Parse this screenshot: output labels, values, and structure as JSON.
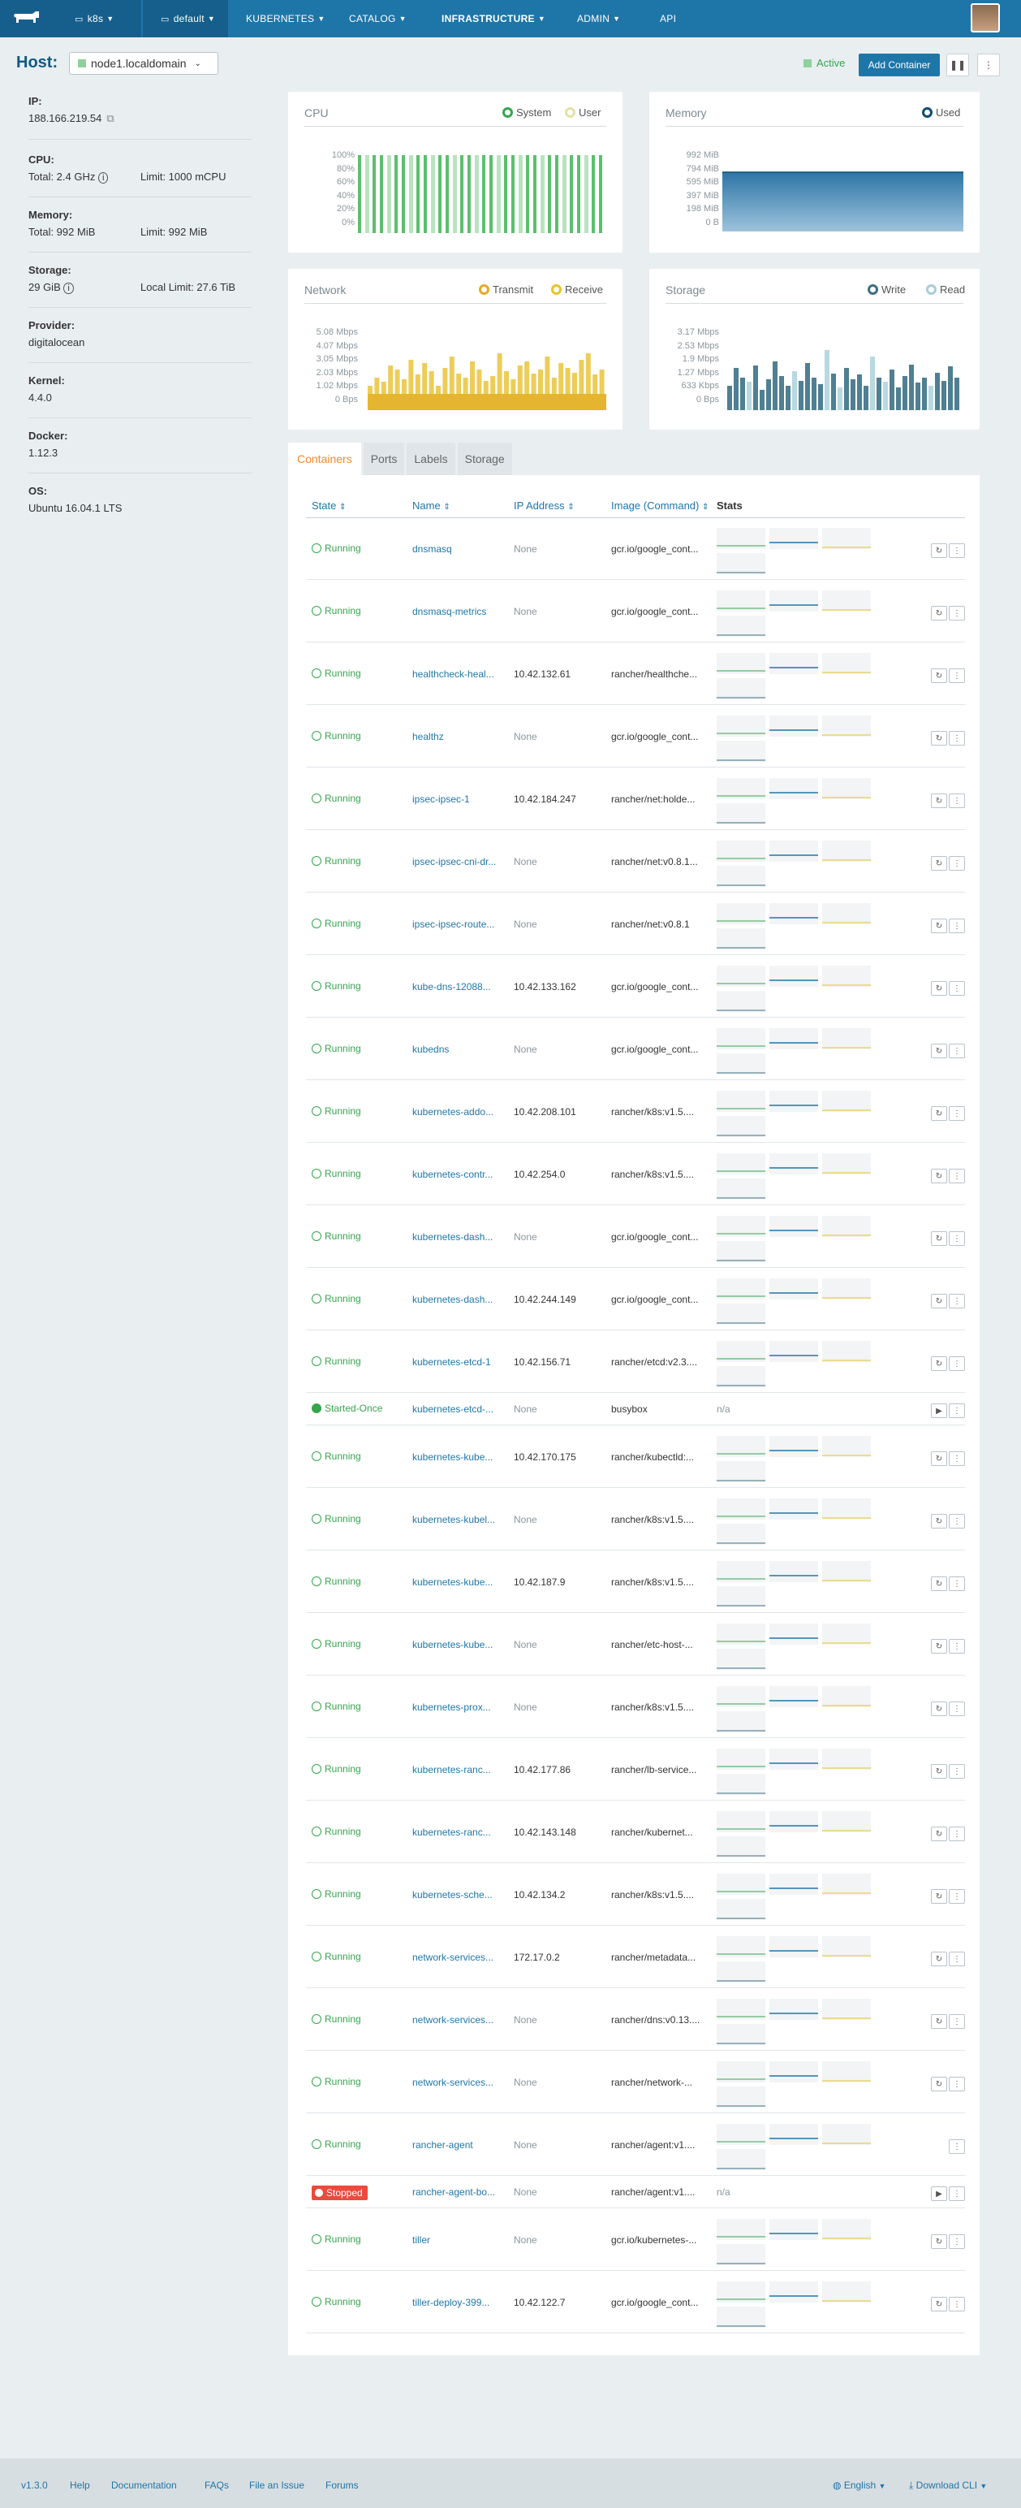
{
  "nav": {
    "cluster": "k8s",
    "environment": "default",
    "menu": [
      "KUBERNETES",
      "CATALOG",
      "INFRASTRUCTURE",
      "ADMIN",
      "API"
    ]
  },
  "host": {
    "label": "Host:",
    "name": "node1.localdomain",
    "state": "Active",
    "add_container": "Add Container"
  },
  "info": {
    "ip_label": "IP:",
    "ip": "188.166.219.54",
    "cpu_label": "CPU:",
    "cpu_total": "Total: 2.4 GHz",
    "cpu_limit": "Limit: 1000 mCPU",
    "mem_label": "Memory:",
    "mem_total": "Total: 992 MiB",
    "mem_limit": "Limit: 992 MiB",
    "storage_label": "Storage:",
    "storage_total": "29 GiB",
    "storage_limit": "Local Limit: 27.6 TiB",
    "provider_label": "Provider:",
    "provider": "digitalocean",
    "kernel_label": "Kernel:",
    "kernel": "4.4.0",
    "docker_label": "Docker:",
    "docker": "1.12.3",
    "os_label": "OS:",
    "os": "Ubuntu 16.04.1 LTS"
  },
  "charts": {
    "cpu": {
      "title": "CPU",
      "legend": [
        "System",
        "User"
      ],
      "ticks": [
        "100%",
        "80%",
        "60%",
        "40%",
        "20%",
        "0%"
      ]
    },
    "memory": {
      "title": "Memory",
      "legend": [
        "Used"
      ],
      "ticks": [
        "992 MiB",
        "794 MiB",
        "595 MiB",
        "397 MiB",
        "198 MiB",
        "0 B"
      ]
    },
    "network": {
      "title": "Network",
      "legend": [
        "Transmit",
        "Receive"
      ],
      "ticks": [
        "5.08 Mbps",
        "4.07 Mbps",
        "3.05 Mbps",
        "2.03 Mbps",
        "1.02 Mbps",
        "0 Bps"
      ]
    },
    "storage": {
      "title": "Storage",
      "legend": [
        "Write",
        "Read"
      ],
      "ticks": [
        "3.17 Mbps",
        "2.53 Mbps",
        "1.9 Mbps",
        "1.27 Mbps",
        "633 Kbps",
        "0 Bps"
      ]
    }
  },
  "tabs": [
    "Containers",
    "Ports",
    "Labels",
    "Storage"
  ],
  "columns": [
    "State",
    "Name",
    "IP Address",
    "Image (Command)",
    "Stats"
  ],
  "containers": [
    {
      "state": "Running",
      "name": "dnsmasq",
      "ip": "None",
      "image": "gcr.io/google_cont..."
    },
    {
      "state": "Running",
      "name": "dnsmasq-metrics",
      "ip": "None",
      "image": "gcr.io/google_cont..."
    },
    {
      "state": "Running",
      "name": "healthcheck-heal...",
      "ip": "10.42.132.61",
      "image": "rancher/healthche..."
    },
    {
      "state": "Running",
      "name": "healthz",
      "ip": "None",
      "image": "gcr.io/google_cont..."
    },
    {
      "state": "Running",
      "name": "ipsec-ipsec-1",
      "ip": "10.42.184.247",
      "image": "rancher/net:holde..."
    },
    {
      "state": "Running",
      "name": "ipsec-ipsec-cni-dr...",
      "ip": "None",
      "image": "rancher/net:v0.8.1..."
    },
    {
      "state": "Running",
      "name": "ipsec-ipsec-route...",
      "ip": "None",
      "image": "rancher/net:v0.8.1"
    },
    {
      "state": "Running",
      "name": "kube-dns-12088...",
      "ip": "10.42.133.162",
      "image": "gcr.io/google_cont..."
    },
    {
      "state": "Running",
      "name": "kubedns",
      "ip": "None",
      "image": "gcr.io/google_cont..."
    },
    {
      "state": "Running",
      "name": "kubernetes-addo...",
      "ip": "10.42.208.101",
      "image": "rancher/k8s:v1.5...."
    },
    {
      "state": "Running",
      "name": "kubernetes-contr...",
      "ip": "10.42.254.0",
      "image": "rancher/k8s:v1.5...."
    },
    {
      "state": "Running",
      "name": "kubernetes-dash...",
      "ip": "None",
      "image": "gcr.io/google_cont..."
    },
    {
      "state": "Running",
      "name": "kubernetes-dash...",
      "ip": "10.42.244.149",
      "image": "gcr.io/google_cont..."
    },
    {
      "state": "Running",
      "name": "kubernetes-etcd-1",
      "ip": "10.42.156.71",
      "image": "rancher/etcd:v2.3...."
    },
    {
      "state": "Started-Once",
      "name": "kubernetes-etcd-...",
      "ip": "None",
      "image": "busybox",
      "stats": "n/a"
    },
    {
      "state": "Running",
      "name": "kubernetes-kube...",
      "ip": "10.42.170.175",
      "image": "rancher/kubectld:..."
    },
    {
      "state": "Running",
      "name": "kubernetes-kubel...",
      "ip": "None",
      "image": "rancher/k8s:v1.5...."
    },
    {
      "state": "Running",
      "name": "kubernetes-kube...",
      "ip": "10.42.187.9",
      "image": "rancher/k8s:v1.5...."
    },
    {
      "state": "Running",
      "name": "kubernetes-kube...",
      "ip": "None",
      "image": "rancher/etc-host-..."
    },
    {
      "state": "Running",
      "name": "kubernetes-prox...",
      "ip": "None",
      "image": "rancher/k8s:v1.5...."
    },
    {
      "state": "Running",
      "name": "kubernetes-ranc...",
      "ip": "10.42.177.86",
      "image": "rancher/lb-service..."
    },
    {
      "state": "Running",
      "name": "kubernetes-ranc...",
      "ip": "10.42.143.148",
      "image": "rancher/kubernet..."
    },
    {
      "state": "Running",
      "name": "kubernetes-sche...",
      "ip": "10.42.134.2",
      "image": "rancher/k8s:v1.5...."
    },
    {
      "state": "Running",
      "name": "network-services...",
      "ip": "172.17.0.2",
      "image": "rancher/metadata..."
    },
    {
      "state": "Running",
      "name": "network-services...",
      "ip": "None",
      "image": "rancher/dns:v0.13...."
    },
    {
      "state": "Running",
      "name": "network-services...",
      "ip": "None",
      "image": "rancher/network-..."
    },
    {
      "state": "Running",
      "name": "rancher-agent",
      "ip": "None",
      "image": "rancher/agent:v1...."
    },
    {
      "state": "Stopped",
      "name": "rancher-agent-bo...",
      "ip": "None",
      "image": "rancher/agent:v1....",
      "stats": "n/a"
    },
    {
      "state": "Running",
      "name": "tiller",
      "ip": "None",
      "image": "gcr.io/kubernetes-..."
    },
    {
      "state": "Running",
      "name": "tiller-deploy-399...",
      "ip": "10.42.122.7",
      "image": "gcr.io/google_cont..."
    }
  ],
  "footer": {
    "version": "v1.3.0",
    "links": [
      "Help",
      "Documentation",
      "FAQs",
      "File an Issue",
      "Forums"
    ],
    "language": "English",
    "download": "Download CLI"
  },
  "colors": {
    "nav": "#1e76a8",
    "running": "#37a54e",
    "stopped": "#e74c3c",
    "accent_tab": "#f28b2a"
  }
}
